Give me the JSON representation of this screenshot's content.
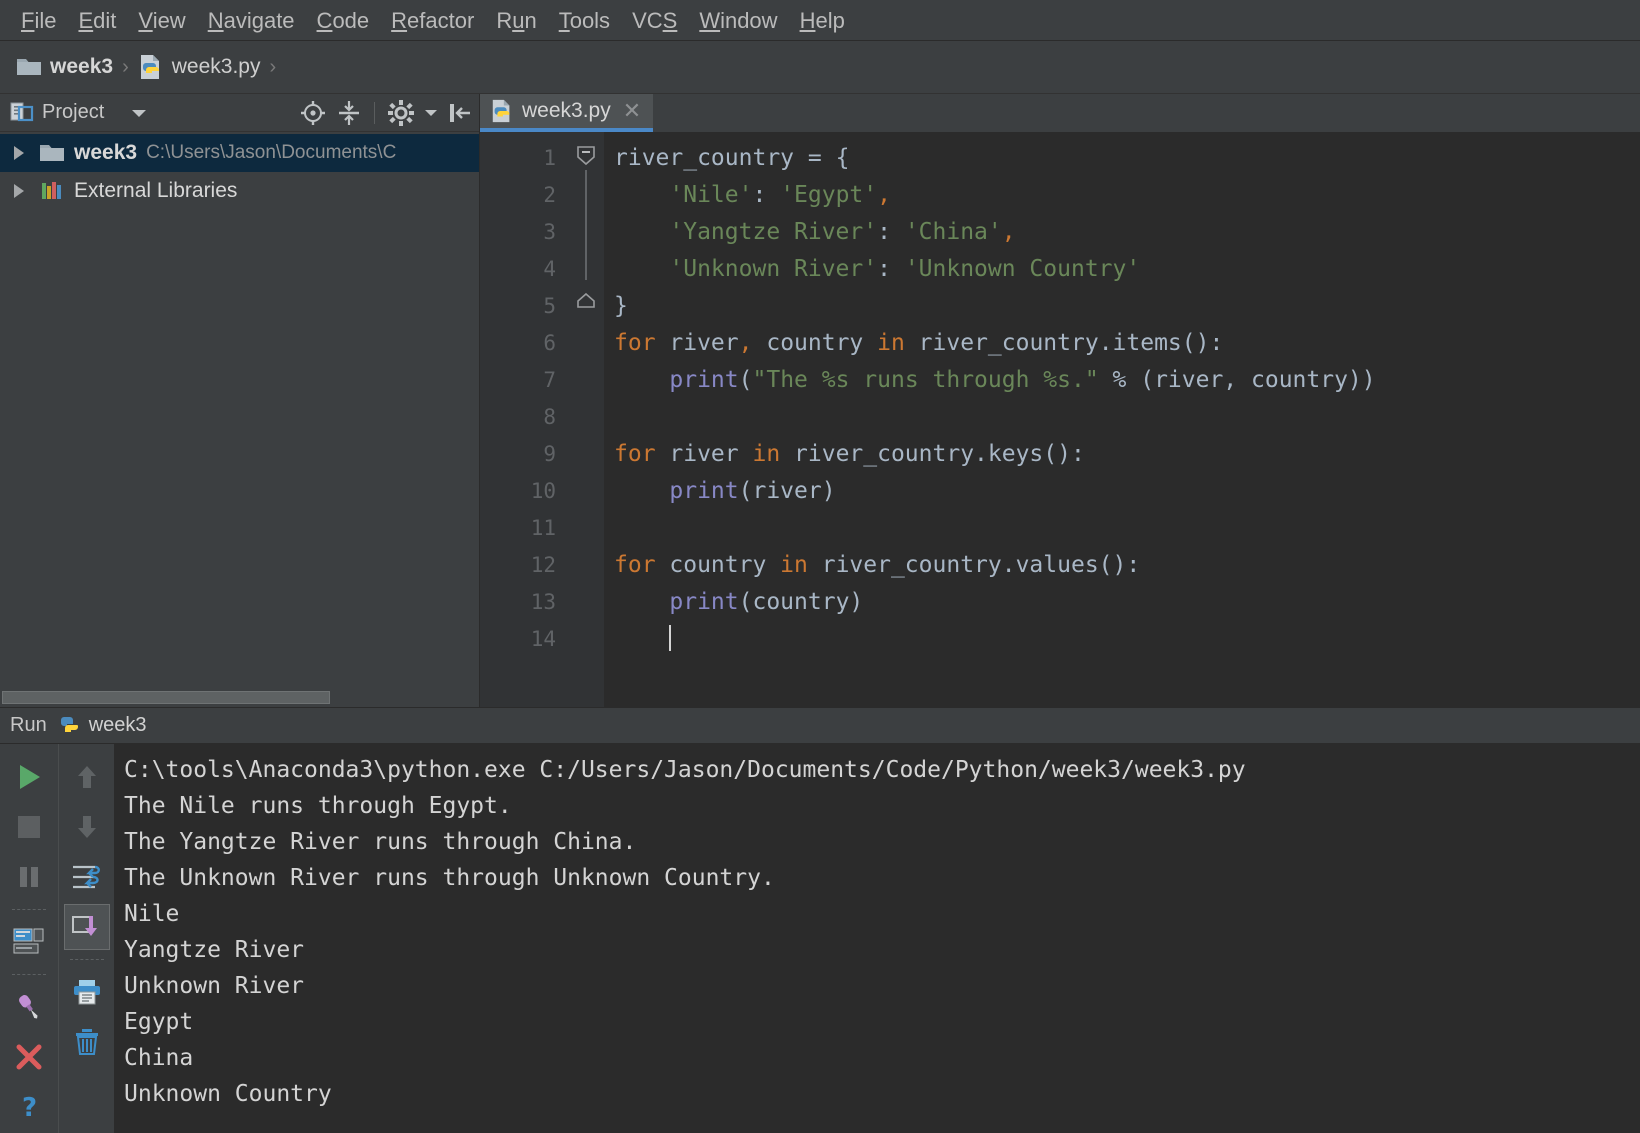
{
  "menubar": {
    "items": [
      {
        "pre": "",
        "mn": "F",
        "post": "ile"
      },
      {
        "pre": "",
        "mn": "E",
        "post": "dit"
      },
      {
        "pre": "",
        "mn": "V",
        "post": "iew"
      },
      {
        "pre": "",
        "mn": "N",
        "post": "avigate"
      },
      {
        "pre": "",
        "mn": "C",
        "post": "ode"
      },
      {
        "pre": "",
        "mn": "R",
        "post": "efactor"
      },
      {
        "pre": "R",
        "mn": "u",
        "post": "n"
      },
      {
        "pre": "",
        "mn": "T",
        "post": "ools"
      },
      {
        "pre": "VC",
        "mn": "S",
        "post": ""
      },
      {
        "pre": "",
        "mn": "W",
        "post": "indow"
      },
      {
        "pre": "",
        "mn": "H",
        "post": "elp"
      }
    ]
  },
  "breadcrumb": {
    "folder": "week3",
    "file": "week3.py",
    "sep": "›",
    "folder_icon": "folder-icon",
    "file_icon": "python-file-icon"
  },
  "project_panel": {
    "title": "Project",
    "caret_icon": "chevron-down-icon",
    "tools": [
      {
        "name": "locate-in-tree-icon"
      },
      {
        "name": "collapse-all-icon"
      },
      {
        "name": "settings-gear-icon"
      },
      {
        "name": "hide-panel-icon"
      }
    ],
    "tree": [
      {
        "label": "week3",
        "path": "C:\\Users\\Jason\\Documents\\C",
        "icon": "folder-icon",
        "expander": "triangle-right-icon",
        "selected": true
      },
      {
        "label": "External Libraries",
        "path": "",
        "icon": "libraries-icon",
        "expander": "triangle-right-icon",
        "selected": false
      }
    ]
  },
  "editor": {
    "tab": {
      "label": "week3.py",
      "icon": "python-file-icon",
      "close_icon": "close-icon",
      "active": true
    },
    "line_numbers": [
      "1",
      "2",
      "3",
      "4",
      "5",
      "6",
      "7",
      "8",
      "9",
      "10",
      "11",
      "12",
      "13",
      "14"
    ],
    "lines": [
      [
        {
          "t": "river_country ",
          "c": "id"
        },
        {
          "t": "= {",
          "c": "op"
        }
      ],
      [
        {
          "t": "    ",
          "c": "id"
        },
        {
          "t": "'Nile'",
          "c": "str"
        },
        {
          "t": ": ",
          "c": "op"
        },
        {
          "t": "'Egypt'",
          "c": "str"
        },
        {
          "t": ",",
          "c": "comma"
        }
      ],
      [
        {
          "t": "    ",
          "c": "id"
        },
        {
          "t": "'Yangtze River'",
          "c": "str"
        },
        {
          "t": ": ",
          "c": "op"
        },
        {
          "t": "'China'",
          "c": "str"
        },
        {
          "t": ",",
          "c": "comma"
        }
      ],
      [
        {
          "t": "    ",
          "c": "id"
        },
        {
          "t": "'Unknown River'",
          "c": "str"
        },
        {
          "t": ": ",
          "c": "op"
        },
        {
          "t": "'Unknown Country'",
          "c": "str"
        }
      ],
      [
        {
          "t": "}",
          "c": "op"
        }
      ],
      [
        {
          "t": "for",
          "c": "kw"
        },
        {
          "t": " river",
          "c": "id"
        },
        {
          "t": ",",
          "c": "comma"
        },
        {
          "t": " country ",
          "c": "id"
        },
        {
          "t": "in",
          "c": "kw"
        },
        {
          "t": " river_country.items():",
          "c": "id"
        }
      ],
      [
        {
          "t": "    ",
          "c": "id"
        },
        {
          "t": "print",
          "c": "fn"
        },
        {
          "t": "(",
          "c": "op"
        },
        {
          "t": "\"The %s runs through %s.\"",
          "c": "str"
        },
        {
          "t": " % (river, country))",
          "c": "id"
        }
      ],
      [
        {
          "t": "",
          "c": "id"
        }
      ],
      [
        {
          "t": "for",
          "c": "kw"
        },
        {
          "t": " river ",
          "c": "id"
        },
        {
          "t": "in",
          "c": "kw"
        },
        {
          "t": " river_country.keys():",
          "c": "id"
        }
      ],
      [
        {
          "t": "    ",
          "c": "id"
        },
        {
          "t": "print",
          "c": "fn"
        },
        {
          "t": "(river)",
          "c": "op"
        }
      ],
      [
        {
          "t": "",
          "c": "id"
        }
      ],
      [
        {
          "t": "for",
          "c": "kw"
        },
        {
          "t": " country ",
          "c": "id"
        },
        {
          "t": "in",
          "c": "kw"
        },
        {
          "t": " river_country.values():",
          "c": "id"
        }
      ],
      [
        {
          "t": "    ",
          "c": "id"
        },
        {
          "t": "print",
          "c": "fn"
        },
        {
          "t": "(country)",
          "c": "op"
        }
      ],
      [
        {
          "t": "",
          "c": "caretline"
        }
      ]
    ],
    "caret_line": 14,
    "fold_markers": [
      {
        "line": 1,
        "icon": "fold-collapse-icon"
      },
      {
        "line": 5,
        "icon": "fold-end-icon"
      }
    ]
  },
  "run_panel": {
    "header_label": "Run",
    "tab_label": "week3",
    "tab_icon": "python-icon",
    "left_tools": [
      {
        "name": "rerun-button",
        "icon": "play-icon"
      },
      {
        "name": "stop-button",
        "icon": "stop-square-icon"
      },
      {
        "name": "pause-button",
        "icon": "pause-icon"
      },
      {
        "name": "layout-settings-button",
        "icon": "console-layout-icon"
      },
      {
        "name": "pin-tab-button",
        "icon": "pin-icon"
      },
      {
        "name": "close-button",
        "icon": "close-x-icon"
      },
      {
        "name": "help-button",
        "icon": "question-mark-icon"
      }
    ],
    "right_tools": [
      {
        "name": "up-button",
        "icon": "arrow-up-icon",
        "active": false
      },
      {
        "name": "down-button",
        "icon": "arrow-down-icon",
        "active": false
      },
      {
        "name": "soft-wrap-button",
        "icon": "soft-wrap-icon",
        "active": false
      },
      {
        "name": "scroll-to-end-button",
        "icon": "scroll-to-end-icon",
        "active": true
      },
      {
        "name": "print-button",
        "icon": "print-icon",
        "active": false
      },
      {
        "name": "clear-all-button",
        "icon": "trash-icon",
        "active": false
      }
    ],
    "console_lines": [
      "C:\\tools\\Anaconda3\\python.exe C:/Users/Jason/Documents/Code/Python/week3/week3.py",
      "The Nile runs through Egypt.",
      "The Yangtze River runs through China.",
      "The Unknown River runs through Unknown Country.",
      "Nile",
      "Yangtze River",
      "Unknown River",
      "Egypt",
      "China",
      "Unknown Country"
    ]
  },
  "colors": {
    "chrome": "#3c3f41",
    "editor_bg": "#2b2b2b",
    "gutter_bg": "#313335",
    "selection": "#0d293e",
    "tab_underline": "#4a88c7",
    "keyword": "#cc7832",
    "string": "#6a8759",
    "function": "#8888c6",
    "identifier": "#a9b7c6",
    "text": "#d4d4d4"
  }
}
